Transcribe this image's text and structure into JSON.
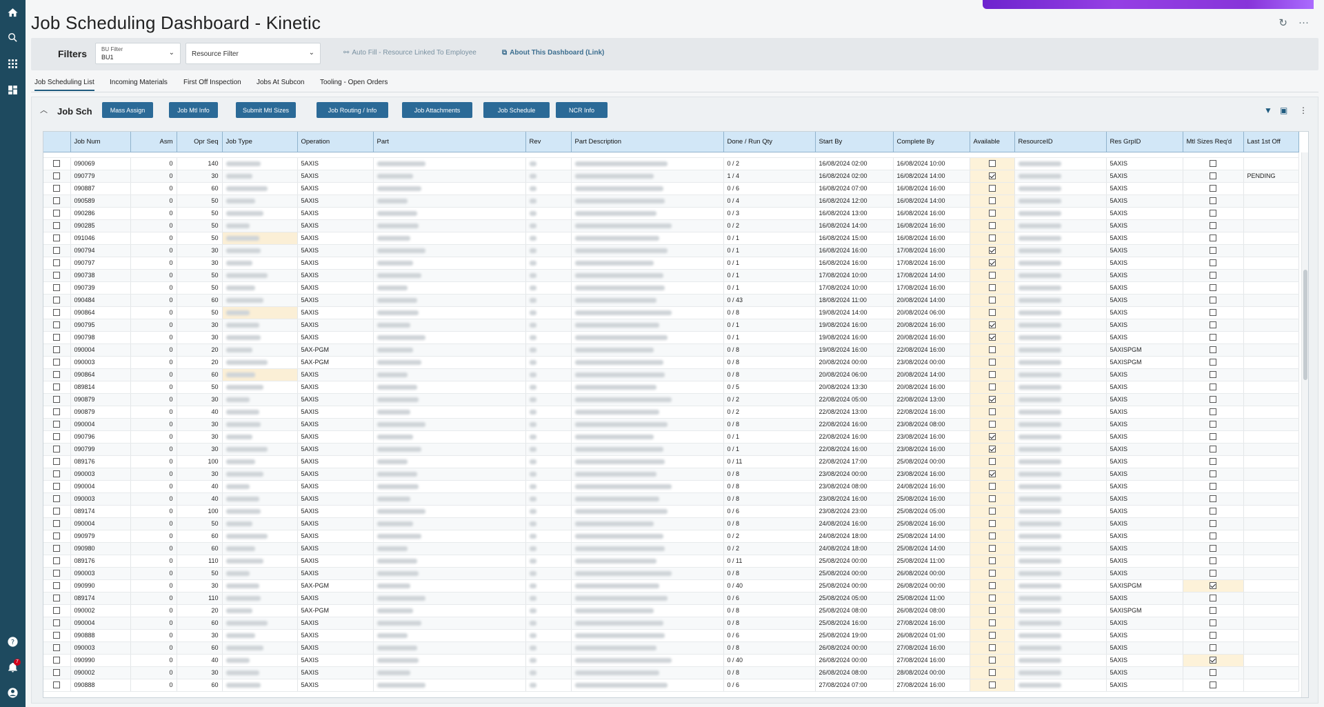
{
  "page_title": "Job Scheduling Dashboard - Kinetic",
  "top_icons": {
    "refresh": "↻",
    "more": "···"
  },
  "filters": {
    "label": "Filters",
    "bu_filter_label": "BU Filter",
    "bu_filter_value": "BU1",
    "resource_filter_placeholder": "Resource Filter",
    "auto_fill_link": "Auto Fill - Resource Linked To Employee",
    "about_link": "About This Dashboard (Link)"
  },
  "tabs": [
    "Job Scheduling List",
    "Incoming Materials",
    "First Off Inspection",
    "Jobs At Subcon",
    "Tooling - Open Orders"
  ],
  "panel": {
    "title": "Job Sch",
    "buttons": [
      "Mass Assign",
      "Job Mtl Info",
      "Submit Mtl Sizes",
      "Job Routing / Info",
      "Job Attachments",
      "Job Schedule",
      "NCR Info"
    ]
  },
  "grid": {
    "columns": [
      "Job Num",
      "Asm",
      "Opr Seq",
      "Job Type",
      "Operation",
      "Part",
      "Rev",
      "Part Description",
      "Done / Run Qty",
      "Start By",
      "Complete By",
      "Available",
      "ResourceID",
      "Res GrpID",
      "Mtl Sizes Req'd",
      "Last 1st Off"
    ],
    "rows": [
      [
        "090069",
        "0",
        "140",
        "5AXIS",
        "0 / 2",
        "16/08/2024 02:00",
        "16/08/2024 10:00",
        false,
        "5AXIS",
        false,
        ""
      ],
      [
        "090779",
        "0",
        "30",
        "5AXIS",
        "1 / 4",
        "16/08/2024 02:00",
        "16/08/2024 14:00",
        true,
        "5AXIS",
        false,
        "PENDING"
      ],
      [
        "090887",
        "0",
        "60",
        "5AXIS",
        "0 / 6",
        "16/08/2024 07:00",
        "16/08/2024 16:00",
        false,
        "5AXIS",
        false,
        ""
      ],
      [
        "090589",
        "0",
        "50",
        "5AXIS",
        "0 / 4",
        "16/08/2024 12:00",
        "16/08/2024 14:00",
        false,
        "5AXIS",
        false,
        ""
      ],
      [
        "090286",
        "0",
        "50",
        "5AXIS",
        "0 / 3",
        "16/08/2024 13:00",
        "16/08/2024 16:00",
        false,
        "5AXIS",
        false,
        ""
      ],
      [
        "090285",
        "0",
        "50",
        "5AXIS",
        "0 / 2",
        "16/08/2024 14:00",
        "16/08/2024 16:00",
        false,
        "5AXIS",
        false,
        ""
      ],
      [
        "091046",
        "0",
        "50",
        "5AXIS",
        "0 / 1",
        "16/08/2024 15:00",
        "16/08/2024 16:00",
        false,
        "5AXIS",
        false,
        ""
      ],
      [
        "090794",
        "0",
        "30",
        "5AXIS",
        "0 / 1",
        "16/08/2024 16:00",
        "17/08/2024 16:00",
        true,
        "5AXIS",
        false,
        ""
      ],
      [
        "090797",
        "0",
        "30",
        "5AXIS",
        "0 / 1",
        "16/08/2024 16:00",
        "17/08/2024 16:00",
        true,
        "5AXIS",
        false,
        ""
      ],
      [
        "090738",
        "0",
        "50",
        "5AXIS",
        "0 / 1",
        "17/08/2024 10:00",
        "17/08/2024 14:00",
        false,
        "5AXIS",
        false,
        ""
      ],
      [
        "090739",
        "0",
        "50",
        "5AXIS",
        "0 / 1",
        "17/08/2024 10:00",
        "17/08/2024 16:00",
        false,
        "5AXIS",
        false,
        ""
      ],
      [
        "090484",
        "0",
        "60",
        "5AXIS",
        "0 / 43",
        "18/08/2024 11:00",
        "20/08/2024 14:00",
        false,
        "5AXIS",
        false,
        ""
      ],
      [
        "090864",
        "0",
        "50",
        "5AXIS",
        "0 / 8",
        "19/08/2024 14:00",
        "20/08/2024 06:00",
        false,
        "5AXIS",
        false,
        ""
      ],
      [
        "090795",
        "0",
        "30",
        "5AXIS",
        "0 / 1",
        "19/08/2024 16:00",
        "20/08/2024 16:00",
        true,
        "5AXIS",
        false,
        ""
      ],
      [
        "090798",
        "0",
        "30",
        "5AXIS",
        "0 / 1",
        "19/08/2024 16:00",
        "20/08/2024 16:00",
        true,
        "5AXIS",
        false,
        ""
      ],
      [
        "090004",
        "0",
        "20",
        "5AX-PGM",
        "0 / 8",
        "19/08/2024 16:00",
        "22/08/2024 16:00",
        false,
        "5AXISPGM",
        false,
        ""
      ],
      [
        "090003",
        "0",
        "20",
        "5AX-PGM",
        "0 / 8",
        "20/08/2024 00:00",
        "23/08/2024 00:00",
        false,
        "5AXISPGM",
        false,
        ""
      ],
      [
        "090864",
        "0",
        "60",
        "5AXIS",
        "0 / 8",
        "20/08/2024 06:00",
        "20/08/2024 14:00",
        false,
        "5AXIS",
        false,
        ""
      ],
      [
        "089814",
        "0",
        "50",
        "5AXIS",
        "0 / 5",
        "20/08/2024 13:30",
        "20/08/2024 16:00",
        false,
        "5AXIS",
        false,
        ""
      ],
      [
        "090879",
        "0",
        "30",
        "5AXIS",
        "0 / 2",
        "22/08/2024 05:00",
        "22/08/2024 13:00",
        true,
        "5AXIS",
        false,
        ""
      ],
      [
        "090879",
        "0",
        "40",
        "5AXIS",
        "0 / 2",
        "22/08/2024 13:00",
        "22/08/2024 16:00",
        false,
        "5AXIS",
        false,
        ""
      ],
      [
        "090004",
        "0",
        "30",
        "5AXIS",
        "0 / 8",
        "22/08/2024 16:00",
        "23/08/2024 08:00",
        false,
        "5AXIS",
        false,
        ""
      ],
      [
        "090796",
        "0",
        "30",
        "5AXIS",
        "0 / 1",
        "22/08/2024 16:00",
        "23/08/2024 16:00",
        true,
        "5AXIS",
        false,
        ""
      ],
      [
        "090799",
        "0",
        "30",
        "5AXIS",
        "0 / 1",
        "22/08/2024 16:00",
        "23/08/2024 16:00",
        true,
        "5AXIS",
        false,
        ""
      ],
      [
        "089176",
        "0",
        "100",
        "5AXIS",
        "0 / 11",
        "22/08/2024 17:00",
        "25/08/2024 00:00",
        false,
        "5AXIS",
        false,
        ""
      ],
      [
        "090003",
        "0",
        "30",
        "5AXIS",
        "0 / 8",
        "23/08/2024 00:00",
        "23/08/2024 16:00",
        true,
        "5AXIS",
        false,
        ""
      ],
      [
        "090004",
        "0",
        "40",
        "5AXIS",
        "0 / 8",
        "23/08/2024 08:00",
        "24/08/2024 16:00",
        false,
        "5AXIS",
        false,
        ""
      ],
      [
        "090003",
        "0",
        "40",
        "5AXIS",
        "0 / 8",
        "23/08/2024 16:00",
        "25/08/2024 16:00",
        false,
        "5AXIS",
        false,
        ""
      ],
      [
        "089174",
        "0",
        "100",
        "5AXIS",
        "0 / 6",
        "23/08/2024 23:00",
        "25/08/2024 05:00",
        false,
        "5AXIS",
        false,
        ""
      ],
      [
        "090004",
        "0",
        "50",
        "5AXIS",
        "0 / 8",
        "24/08/2024 16:00",
        "25/08/2024 16:00",
        false,
        "5AXIS",
        false,
        ""
      ],
      [
        "090979",
        "0",
        "60",
        "5AXIS",
        "0 / 2",
        "24/08/2024 18:00",
        "25/08/2024 14:00",
        false,
        "5AXIS",
        false,
        ""
      ],
      [
        "090980",
        "0",
        "60",
        "5AXIS",
        "0 / 2",
        "24/08/2024 18:00",
        "25/08/2024 14:00",
        false,
        "5AXIS",
        false,
        ""
      ],
      [
        "089176",
        "0",
        "110",
        "5AXIS",
        "0 / 11",
        "25/08/2024 00:00",
        "25/08/2024 11:00",
        false,
        "5AXIS",
        false,
        ""
      ],
      [
        "090003",
        "0",
        "50",
        "5AXIS",
        "0 / 8",
        "25/08/2024 00:00",
        "26/08/2024 00:00",
        false,
        "5AXIS",
        false,
        ""
      ],
      [
        "090990",
        "0",
        "30",
        "5AX-PGM",
        "0 / 40",
        "25/08/2024 00:00",
        "26/08/2024 00:00",
        false,
        "5AXISPGM",
        true,
        ""
      ],
      [
        "089174",
        "0",
        "110",
        "5AXIS",
        "0 / 6",
        "25/08/2024 05:00",
        "25/08/2024 11:00",
        false,
        "5AXIS",
        false,
        ""
      ],
      [
        "090002",
        "0",
        "20",
        "5AX-PGM",
        "0 / 8",
        "25/08/2024 08:00",
        "26/08/2024 08:00",
        false,
        "5AXISPGM",
        false,
        ""
      ],
      [
        "090004",
        "0",
        "60",
        "5AXIS",
        "0 / 8",
        "25/08/2024 16:00",
        "27/08/2024 16:00",
        false,
        "5AXIS",
        false,
        ""
      ],
      [
        "090888",
        "0",
        "30",
        "5AXIS",
        "0 / 6",
        "25/08/2024 19:00",
        "26/08/2024 01:00",
        false,
        "5AXIS",
        false,
        ""
      ],
      [
        "090003",
        "0",
        "60",
        "5AXIS",
        "0 / 8",
        "26/08/2024 00:00",
        "27/08/2024 16:00",
        false,
        "5AXIS",
        false,
        ""
      ],
      [
        "090990",
        "0",
        "40",
        "5AXIS",
        "0 / 40",
        "26/08/2024 00:00",
        "27/08/2024 16:00",
        false,
        "5AXIS",
        true,
        ""
      ],
      [
        "090002",
        "0",
        "30",
        "5AXIS",
        "0 / 8",
        "26/08/2024 08:00",
        "28/08/2024 00:00",
        false,
        "5AXIS",
        false,
        ""
      ],
      [
        "090888",
        "0",
        "60",
        "5AXIS",
        "0 / 6",
        "27/08/2024 07:00",
        "27/08/2024 16:00",
        false,
        "5AXIS",
        false,
        ""
      ]
    ]
  }
}
